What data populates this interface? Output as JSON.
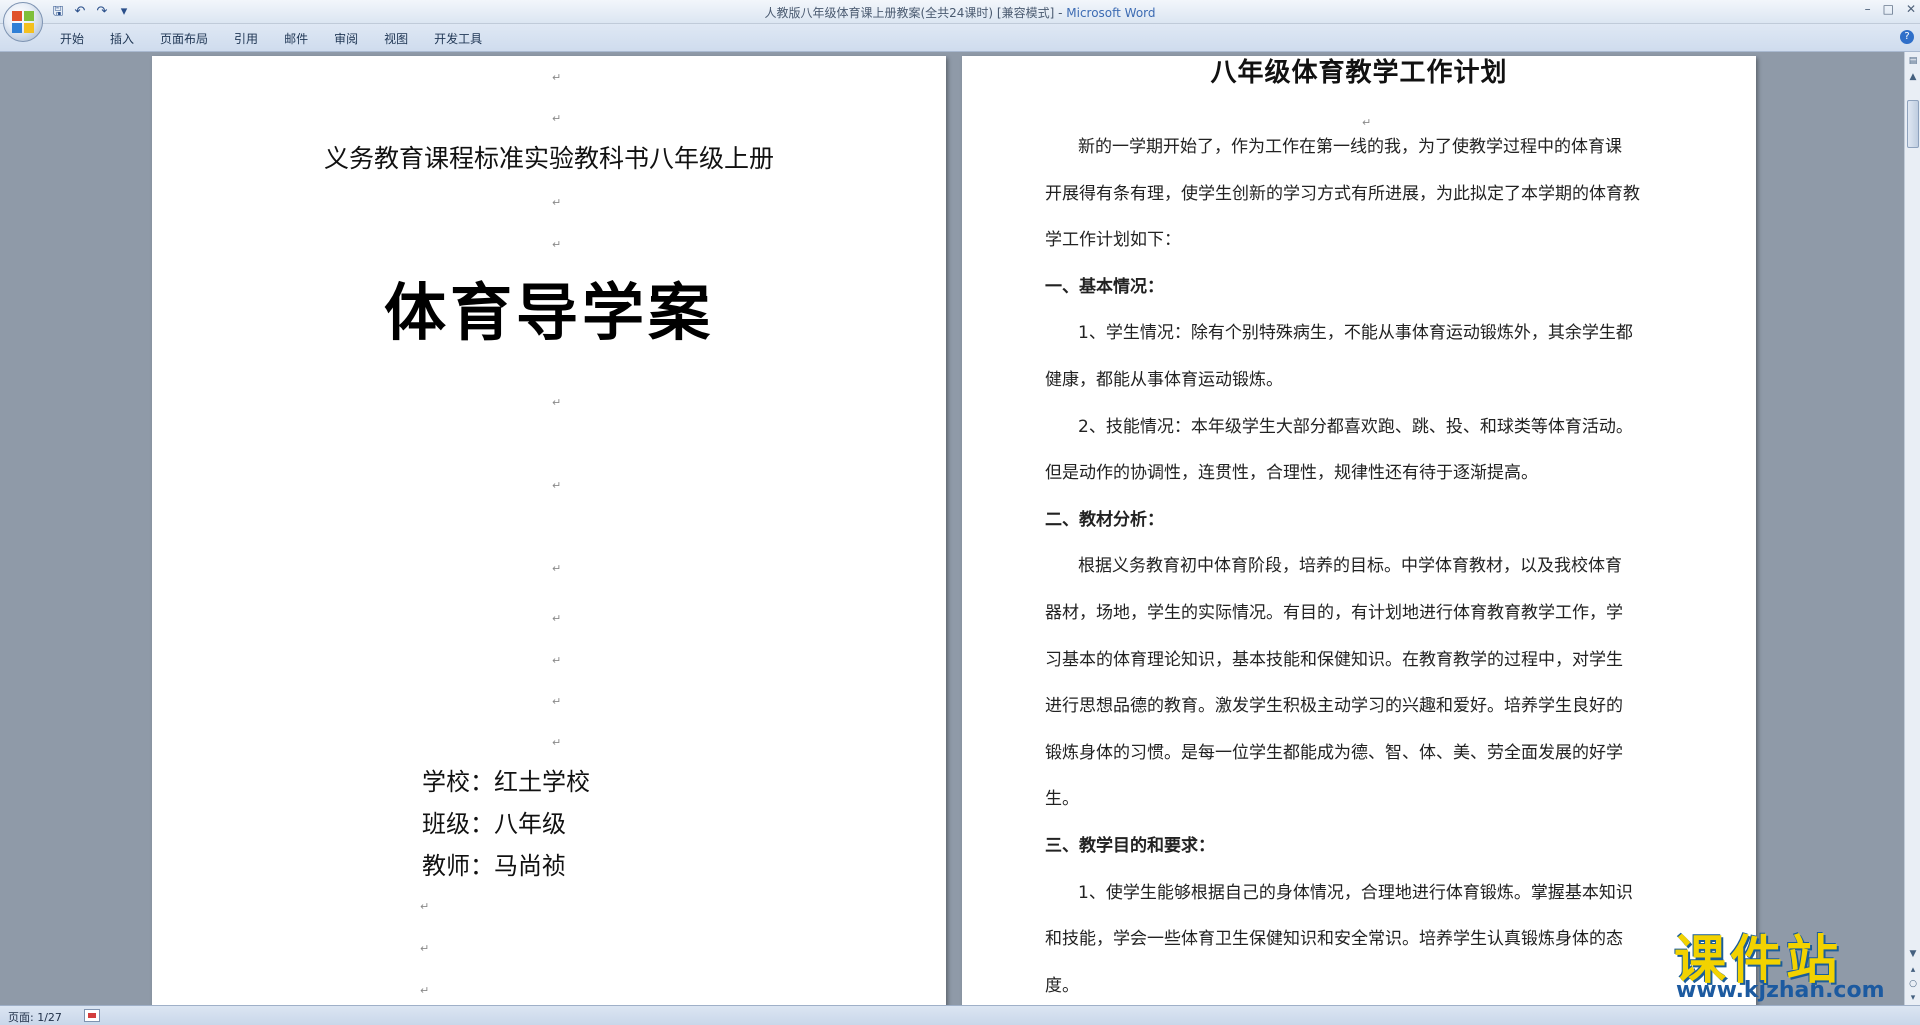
{
  "window": {
    "title": "人教版八年级体育课上册教案(全共24课时) [兼容模式] - ",
    "app_name": "Microsoft Word"
  },
  "ribbon": {
    "tabs": [
      "开始",
      "插入",
      "页面布局",
      "引用",
      "邮件",
      "审阅",
      "视图",
      "开发工具"
    ]
  },
  "icons": {
    "office_button": "office-logo-icon",
    "save": "save-icon",
    "undo": "undo-icon",
    "redo": "redo-icon",
    "customize": "chevron-down-icon",
    "help": "help-icon",
    "paragraph_mark": "paragraph-mark-icon"
  },
  "page1": {
    "subtitle": "义务教育课程标准实验教科书八年级上册",
    "title": "体育导学案",
    "info": [
      {
        "label": "学校：",
        "value": "红土学校"
      },
      {
        "label": "班级：",
        "value": "八年级"
      },
      {
        "label": "教师：",
        "value": "马尚祯"
      }
    ]
  },
  "page2": {
    "title": "八年级体育教学工作计划",
    "lines": [
      {
        "text": "新的一学期开始了，作为工作在第一线的我，为了使教学过程中的体育课",
        "indent": true,
        "bold": false
      },
      {
        "text": "开展得有条有理，使学生创新的学习方式有所进展，为此拟定了本学期的体育教",
        "indent": false,
        "bold": false
      },
      {
        "text": "学工作计划如下：",
        "indent": false,
        "bold": false
      },
      {
        "text": "一、基本情况：",
        "indent": false,
        "bold": true
      },
      {
        "text": "1、学生情况：除有个别特殊病生，不能从事体育运动锻炼外，其余学生都",
        "indent": true,
        "bold": false
      },
      {
        "text": "健康，都能从事体育运动锻炼。",
        "indent": false,
        "bold": false
      },
      {
        "text": "2、技能情况：本年级学生大部分都喜欢跑、跳、投、和球类等体育活动。",
        "indent": true,
        "bold": false
      },
      {
        "text": "但是动作的协调性，连贯性，合理性，规律性还有待于逐渐提高。",
        "indent": false,
        "bold": false
      },
      {
        "text": "二、教材分析：",
        "indent": false,
        "bold": true
      },
      {
        "text": "根据义务教育初中体育阶段，培养的目标。中学体育教材，以及我校体育",
        "indent": true,
        "bold": false
      },
      {
        "text": "器材，场地，学生的实际情况。有目的，有计划地进行体育教育教学工作，学",
        "indent": false,
        "bold": false
      },
      {
        "text": "习基本的体育理论知识，基本技能和保健知识。在教育教学的过程中，对学生",
        "indent": false,
        "bold": false
      },
      {
        "text": "进行思想品德的教育。激发学生积极主动学习的兴趣和爱好。培养学生良好的",
        "indent": false,
        "bold": false
      },
      {
        "text": "锻炼身体的习惯。是每一位学生都能成为德、智、体、美、劳全面发展的好学",
        "indent": false,
        "bold": false
      },
      {
        "text": "生。",
        "indent": false,
        "bold": false
      },
      {
        "text": "三、教学目的和要求：",
        "indent": false,
        "bold": true
      },
      {
        "text": "1、使学生能够根据自己的身体情况，合理地进行体育锻炼。掌握基本知识",
        "indent": true,
        "bold": false
      },
      {
        "text": "和技能，学会一些体育卫生保健知识和安全常识。培养学生认真锻炼身体的态",
        "indent": false,
        "bold": false
      },
      {
        "text": "度。",
        "indent": false,
        "bold": false
      }
    ]
  },
  "status": {
    "page": "页面: 1/27"
  },
  "watermark": {
    "text": "课件站",
    "url": "www.kjzhan.com"
  },
  "colors": {
    "workspace": "#8f9aa8",
    "accent": "#3c6bb3",
    "watermark_yellow": "#f2d200",
    "watermark_blue": "#1c5aa0"
  }
}
